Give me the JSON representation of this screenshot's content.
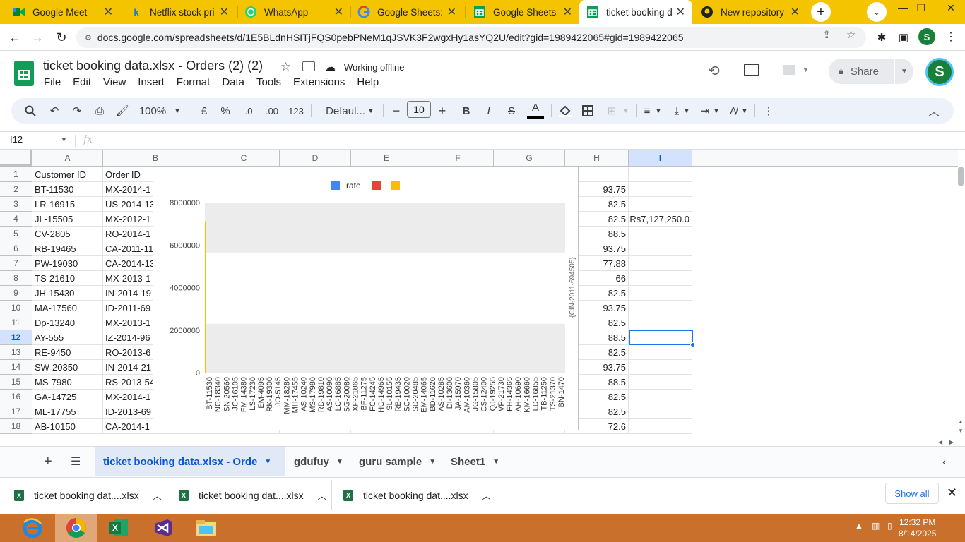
{
  "browser": {
    "tabs": [
      {
        "label": "Google Meet",
        "icon": "google-meet-icon"
      },
      {
        "label": "Netflix stock price",
        "icon": "k-icon"
      },
      {
        "label": "WhatsApp",
        "icon": "whatsapp-icon"
      },
      {
        "label": "Google Sheets: Or",
        "icon": "google-icon"
      },
      {
        "label": "Google Sheets",
        "icon": "sheets-icon"
      },
      {
        "label": "ticket booking dat",
        "icon": "sheets-icon",
        "active": true
      },
      {
        "label": "New repository",
        "icon": "github-icon"
      }
    ],
    "url": "docs.google.com/spreadsheets/d/1E5BLdnHSITjFQS0pebPNeM1qJSVK3F2wgxHy1asYQ2U/edit?gid=1989422065#gid=1989422065",
    "profile_initial": "S",
    "accent": "#f5c400"
  },
  "doc": {
    "title": "ticket booking data.xlsx - Orders (2) (2)",
    "status": "Working offline",
    "menu": [
      "File",
      "Edit",
      "View",
      "Insert",
      "Format",
      "Data",
      "Tools",
      "Extensions",
      "Help"
    ],
    "share_label": "Share",
    "account_initial": "S"
  },
  "toolbar": {
    "zoom": "100%",
    "currency": "£",
    "percent": "%",
    "dec_decrease": ".0",
    "dec_increase": ".00",
    "format_123": "123",
    "font": "Defaul...",
    "font_size": "10",
    "bold": "B",
    "italic": "I",
    "strike": "S",
    "text_color": "A"
  },
  "formula_bar": {
    "name_box": "I12",
    "fx": "fx"
  },
  "grid": {
    "columns": [
      "A",
      "B",
      "C",
      "D",
      "E",
      "F",
      "G",
      "H",
      "I"
    ],
    "selected_column": "I",
    "selected_row": "12",
    "rows": [
      {
        "n": "1",
        "a": "Customer ID",
        "b": "Order ID",
        "h": "",
        "i": ""
      },
      {
        "n": "2",
        "a": "BT-11530",
        "b": "MX-2014-1",
        "h": "93.75",
        "i": ""
      },
      {
        "n": "3",
        "a": "LR-16915",
        "b": "US-2014-13",
        "h": "82.5",
        "i": ""
      },
      {
        "n": "4",
        "a": "JL-15505",
        "b": "MX-2012-1",
        "h": "82.5",
        "i": "Rs7,127,250.0"
      },
      {
        "n": "5",
        "a": "CV-2805",
        "b": "RO-2014-1",
        "h": "88.5",
        "i": ""
      },
      {
        "n": "6",
        "a": "RB-19465",
        "b": "CA-2011-11",
        "h": "93.75",
        "i": ""
      },
      {
        "n": "7",
        "a": "PW-19030",
        "b": "CA-2014-13",
        "h": "77.88",
        "i": ""
      },
      {
        "n": "8",
        "a": "TS-21610",
        "b": "MX-2013-1",
        "h": "66",
        "i": ""
      },
      {
        "n": "9",
        "a": "JH-15430",
        "b": "IN-2014-19",
        "h": "82.5",
        "i": ""
      },
      {
        "n": "10",
        "a": "MA-17560",
        "b": "ID-2011-69",
        "h": "93.75",
        "i": ""
      },
      {
        "n": "11",
        "a": "Dp-13240",
        "b": "MX-2013-1",
        "h": "82.5",
        "i": ""
      },
      {
        "n": "12",
        "a": "AY-555",
        "b": "IZ-2014-96",
        "h": "88.5",
        "i": ""
      },
      {
        "n": "13",
        "a": "RE-9450",
        "b": "RO-2013-6",
        "h": "82.5",
        "i": ""
      },
      {
        "n": "14",
        "a": "SW-20350",
        "b": "IN-2014-21",
        "h": "93.75",
        "i": ""
      },
      {
        "n": "15",
        "a": "MS-7980",
        "b": "RS-2013-54",
        "h": "88.5",
        "i": ""
      },
      {
        "n": "16",
        "a": "GA-14725",
        "b": "MX-2014-1",
        "h": "82.5",
        "i": ""
      },
      {
        "n": "17",
        "a": "ML-17755",
        "b": "ID-2013-69",
        "h": "82.5",
        "i": ""
      },
      {
        "n": "18",
        "a": "AB-10150",
        "b": "CA-2014-1",
        "h": "72.6",
        "i": ""
      }
    ]
  },
  "chart_data": {
    "type": "bar",
    "legend": [
      "rate",
      "",
      ""
    ],
    "legend_colors": [
      "#4285f4",
      "#ea4335",
      "#fbbc04"
    ],
    "legend_position": "top",
    "y_ticks": [
      "8000000",
      "6000000",
      "4000000",
      "2000000",
      "0"
    ],
    "ylim": [
      0,
      8000000
    ],
    "right_axis_label": "{CIN-2011-694505}",
    "categories": [
      "BT-11530",
      "NC-18340",
      "SN-20560",
      "JC-16105",
      "FM-14380",
      "LS-17230",
      "EM-4095",
      "RK-19300",
      "JO-5145",
      "MM-18280",
      "MH-17455",
      "AS-10240",
      "MS-17980",
      "RD-19810",
      "AS-10090",
      "LC-16885",
      "SG-20080",
      "XP-21865",
      "BF-11275",
      "FC-14245",
      "HG-14965",
      "SL-10155",
      "RB-19435",
      "SC-10020",
      "SD-20485",
      "EM-14065",
      "BD-11620",
      "AS-10285",
      "DI-13600",
      "JA-15970",
      "AM-10360",
      "JG-15805",
      "CS-12400",
      "QJ-19255",
      "VP-21730",
      "FH-14365",
      "AH-10690",
      "KM-16660",
      "LD-16855",
      "TB-11250",
      "TS-21370",
      "BN-1470"
    ],
    "series": [
      {
        "name": "",
        "color": "#fbbc04",
        "values": [
          7127250,
          0,
          0,
          0,
          0,
          0,
          0,
          0,
          0,
          0,
          0,
          0,
          0,
          0,
          0,
          0,
          0,
          0,
          0,
          0,
          0,
          0,
          0,
          0,
          0,
          0,
          0,
          0,
          0,
          0,
          0,
          0,
          0,
          0,
          0,
          0,
          0,
          0,
          0,
          0,
          0,
          0
        ]
      }
    ],
    "band_color": "#ececec"
  },
  "sheets": {
    "tabs": [
      "ticket booking data.xlsx - Orde",
      "gdufuy",
      "guru sample",
      "Sheet1"
    ],
    "active_index": 0
  },
  "downloads": {
    "items": [
      "ticket booking dat....xlsx",
      "ticket booking dat....xlsx",
      "ticket booking dat....xlsx"
    ],
    "show_all": "Show all"
  },
  "taskbar": {
    "time": "12:32 PM",
    "date": "8/14/2025",
    "color": "#c8702c"
  }
}
